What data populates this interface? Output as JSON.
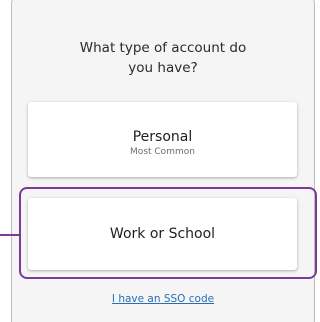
{
  "prompt": {
    "question_line1": "What type of account do",
    "question_line2": "you have?"
  },
  "options": [
    {
      "label": "Personal",
      "sublabel": "Most Common"
    },
    {
      "label": "Work or School"
    }
  ],
  "sso_link": {
    "label": "I have an SSO code"
  },
  "colors": {
    "highlight": "#7b3a96",
    "link": "#2a6fb5",
    "panel_background": "#f5f5f5"
  }
}
